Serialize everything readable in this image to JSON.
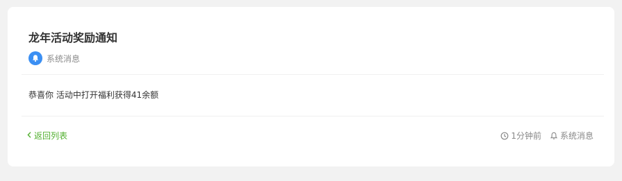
{
  "notice": {
    "title": "龙年活动奖励通知",
    "source_label": "系统消息",
    "message": "恭喜你 活动中打开福利获得41余额",
    "back_label": "返回列表",
    "time_ago": "1分钟前",
    "category": "系统消息"
  },
  "colors": {
    "accent_green": "#52b030",
    "badge_blue": "#3b8ff3"
  },
  "icons": {
    "badge": "bell-icon",
    "back": "chevron-left-icon",
    "time": "clock-icon",
    "category": "bell-outline-icon"
  }
}
